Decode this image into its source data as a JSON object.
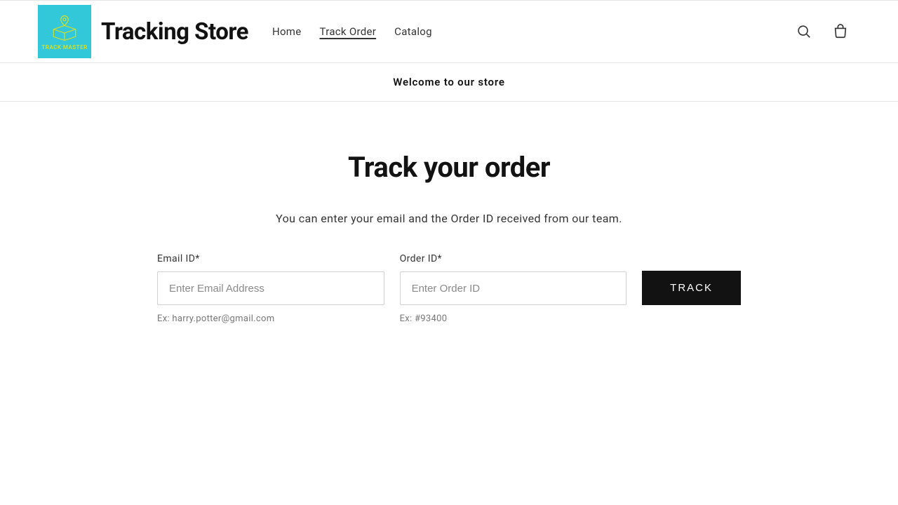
{
  "logo": {
    "tagline": "TRACK MASTER"
  },
  "header": {
    "store_name": "Tracking Store",
    "nav": [
      {
        "label": "Home",
        "active": false
      },
      {
        "label": "Track Order",
        "active": true
      },
      {
        "label": "Catalog",
        "active": false
      }
    ]
  },
  "welcome": "Welcome to our store",
  "tracking": {
    "title": "Track your order",
    "subtitle": "You can enter your email and the Order ID received from our team.",
    "email": {
      "label": "Email ID*",
      "placeholder": "Enter Email Address",
      "hint": "Ex: harry.potter@gmail.com"
    },
    "order": {
      "label": "Order ID*",
      "placeholder": "Enter Order ID",
      "hint": "Ex: #93400"
    },
    "button": "TRACK"
  }
}
